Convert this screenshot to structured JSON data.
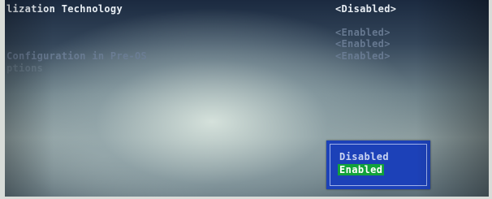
{
  "settings": [
    {
      "label": "lization Technology",
      "value": "<Disabled>"
    },
    {
      "label": "",
      "value": ""
    },
    {
      "label": "",
      "value": "<Enabled>"
    },
    {
      "label": "",
      "value": "<Enabled>"
    },
    {
      "label": "Configuration in Pre-OS",
      "value": "<Enabled>"
    },
    {
      "label": "ptions",
      "value": ""
    }
  ],
  "popup": {
    "options": [
      "Disabled",
      "Enabled"
    ],
    "selected": "Enabled"
  }
}
